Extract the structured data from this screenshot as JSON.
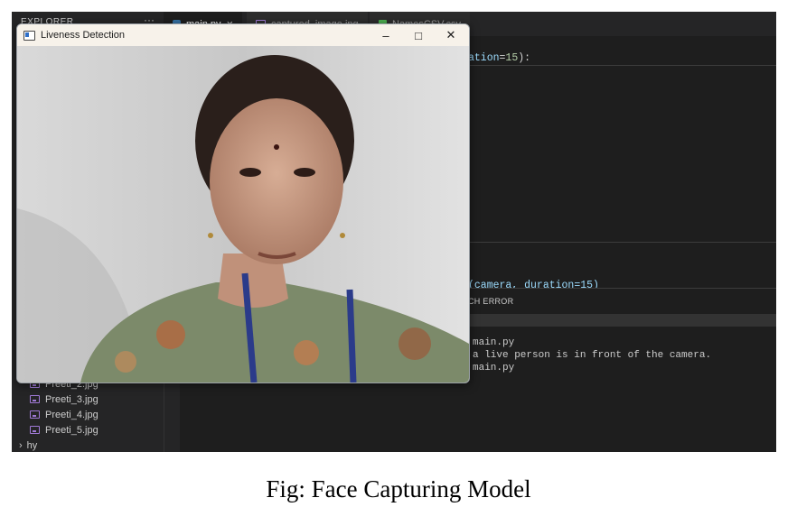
{
  "explorer": {
    "title": "EXPLORER",
    "more": "···",
    "files": [
      "Preeti_2.jpg",
      "Preeti_3.jpg",
      "Preeti_4.jpg",
      "Preeti_5.jpg"
    ],
    "folder": "hy"
  },
  "tabs": [
    {
      "label": "main.py",
      "close": "×"
    },
    {
      "label": "captured_image.jpg"
    },
    {
      "label": "NamesCSV.csv"
    }
  ],
  "editor": {
    "line_top": {
      "kw": "ation",
      "op": "=",
      "num": "15",
      "end": "):"
    },
    "line_bottom": "(camera, duration=15)"
  },
  "panel": {
    "tab_label": "CH ERROR",
    "terminal_lines": [
      "main.py",
      "a live person is in front of the camera.",
      "main.py"
    ]
  },
  "window": {
    "title": "Liveness Detection",
    "minimize": "–",
    "maximize": "□",
    "close": "✕"
  },
  "caption": "Fig: Face Capturing Model"
}
